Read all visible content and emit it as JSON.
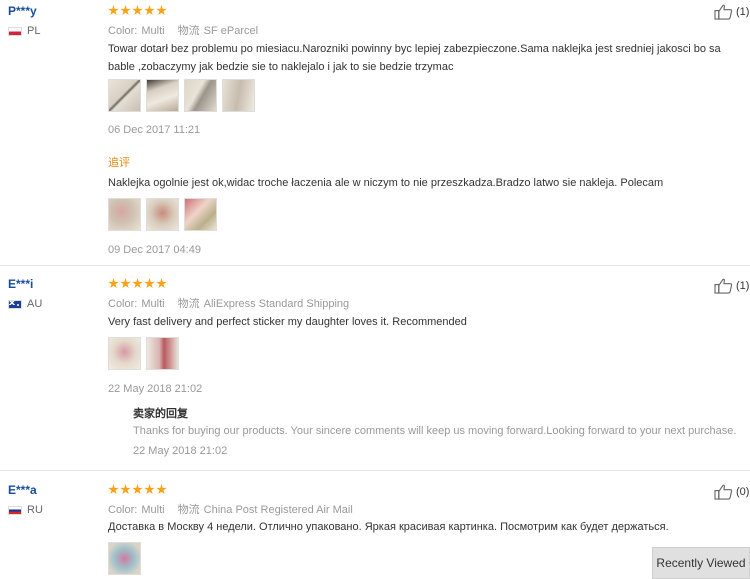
{
  "reviews": [
    {
      "user": "P***y",
      "country": "PL",
      "color_key": "Color:",
      "color_value": "Multi",
      "ship_key": "物流",
      "ship_value": "SF eParcel",
      "text_lines": [
        "Towar dotarł bez problemu po miesiacu.Narozniki powinny byc lepiej zabezpieczone.Sama naklejka jest sredniej jakosci bo sa",
        "bable ,zobaczymy jak bedzie sie to naklejalo i jak to sie bedzie trzymac"
      ],
      "date": "06 Dec 2017 11:21",
      "likes": "(1)",
      "append_label": "追评",
      "append_text": "Naklejka ogolnie jest ok,widac troche łaczenia ale w niczym to nie przeszkadza.Bradzo latwo sie nakleja. Polecam",
      "append_date": "09 Dec 2017 04:49"
    },
    {
      "user": "E***i",
      "country": "AU",
      "color_key": "Color:",
      "color_value": "Multi",
      "ship_key": "物流",
      "ship_value": "AliExpress Standard Shipping",
      "text": "Very fast delivery and perfect sticker my daughter loves it. Recommended",
      "date": "22 May 2018 21:02",
      "likes": "(1)",
      "seller_title": "卖家的回复",
      "seller_text": "Thanks for buying our products. Your sincere comments will keep us moving forward.Looking forward to your next purchase.",
      "seller_date": "22 May 2018 21:02"
    },
    {
      "user": "E***a",
      "country": "RU",
      "color_key": "Color:",
      "color_value": "Multi",
      "ship_key": "物流",
      "ship_value": "China Post Registered Air Mail",
      "text": "Доставка в Москву 4 недели. Отлично упаковано. Яркая красивая картинка. Посмотрим как будет держаться.",
      "likes": "(0)"
    }
  ],
  "recently_viewed": "Recently Viewed",
  "colors": {
    "star": "#f7a21b",
    "user": "#1a4c9c",
    "append": "#e48a0b"
  }
}
